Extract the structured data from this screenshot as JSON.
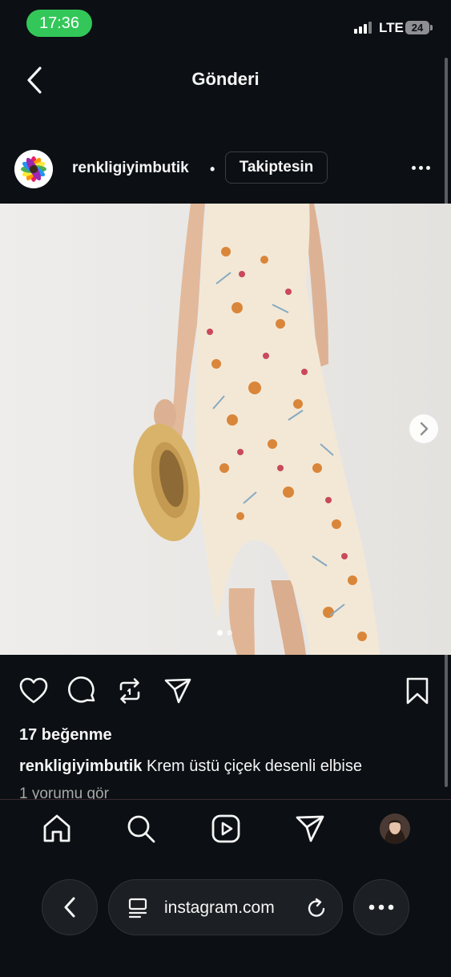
{
  "status_bar": {
    "time": "17:36",
    "network": "LTE",
    "battery": "24"
  },
  "header": {
    "title": "Gönderi"
  },
  "post": {
    "username": "renkligiyimbutik",
    "separator": "•",
    "follow_label": "Takiptesin",
    "likes": "17 beğenme",
    "caption_user": "renkligiyimbutik",
    "caption_text": "Krem üstü çiçek desenli elbise",
    "comments_link": "1 yorumu gör",
    "carousel_count": 2,
    "carousel_active": 1
  },
  "browser": {
    "url": "instagram.com"
  },
  "colors": {
    "background": "#0c1014",
    "time_pill": "#33c759",
    "text": "#f5f5f5",
    "muted": "#a8a8a8"
  }
}
